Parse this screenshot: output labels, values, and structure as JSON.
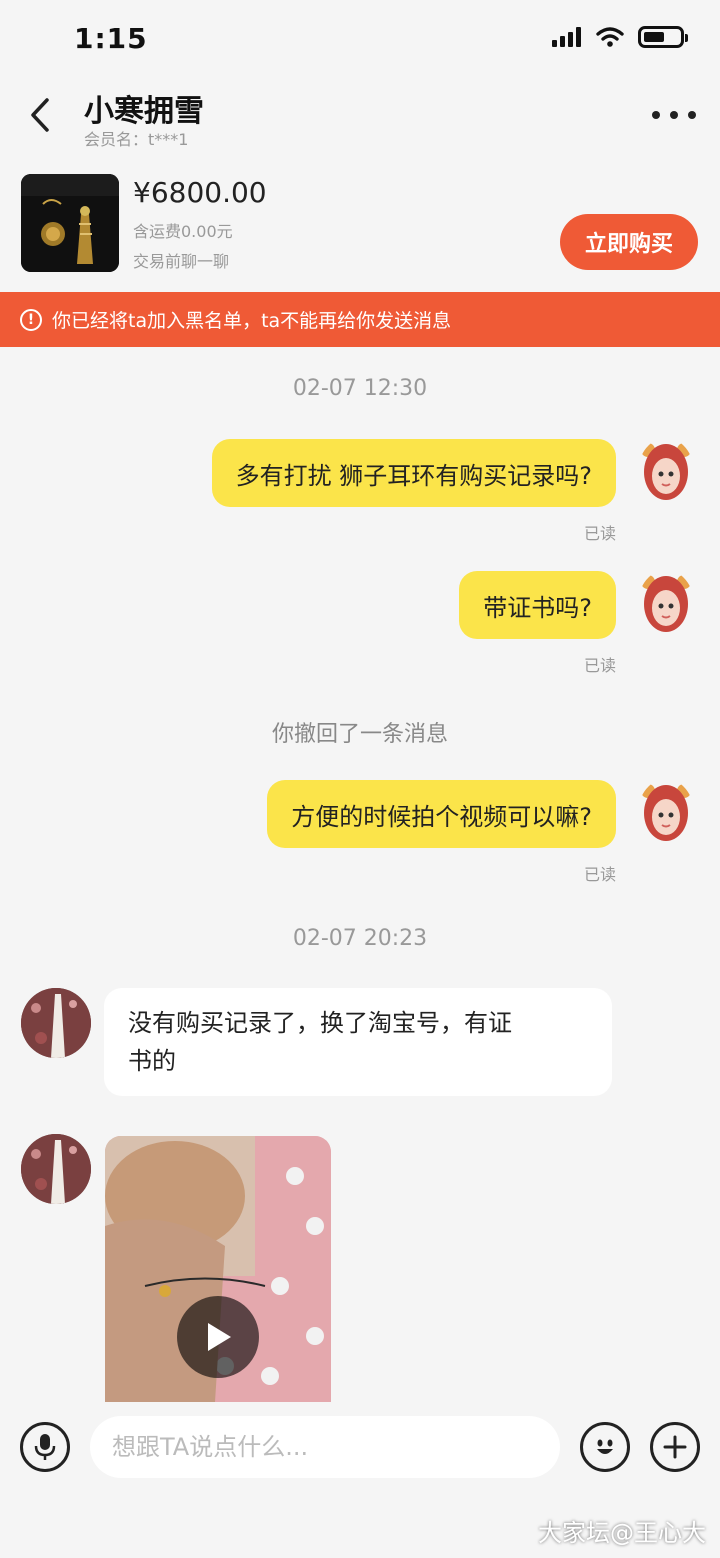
{
  "status": {
    "time": "1:15"
  },
  "header": {
    "title": "小寒拥雪",
    "subtitle": "会员名：t***1"
  },
  "product": {
    "price": "¥6800.00",
    "shipping": "含运费0.00元",
    "chat_before": "交易前聊一聊",
    "buy_label": "立即购买"
  },
  "notice": {
    "icon": "!",
    "text": "你已经将ta加入黑名单，ta不能再给你发送消息"
  },
  "messages": {
    "timestamp1": "02-07 12:30",
    "m1": "多有打扰  狮子耳环有购买记录吗?",
    "m1_status": "已读",
    "m2": "带证书吗?",
    "m2_status": "已读",
    "recall": "你撤回了一条消息",
    "m3": "方便的时候拍个视频可以嘛?",
    "m3_status": "已读",
    "timestamp2": "02-07 20:23",
    "m4_line1": "没有购买记录了，换了淘宝号，有证",
    "m4_line2": "书的"
  },
  "input": {
    "placeholder": "想跟TA说点什么..."
  },
  "watermark": "大家坛@王心大",
  "colors": {
    "accent": "#ef5a36",
    "bubble_self": "#fbe44a"
  },
  "icons": [
    "back-arrow-icon",
    "more-dots-icon",
    "alert-circle-icon",
    "microphone-icon",
    "emoji-icon",
    "plus-icon",
    "play-icon",
    "signal-icon",
    "wifi-icon",
    "battery-icon"
  ]
}
